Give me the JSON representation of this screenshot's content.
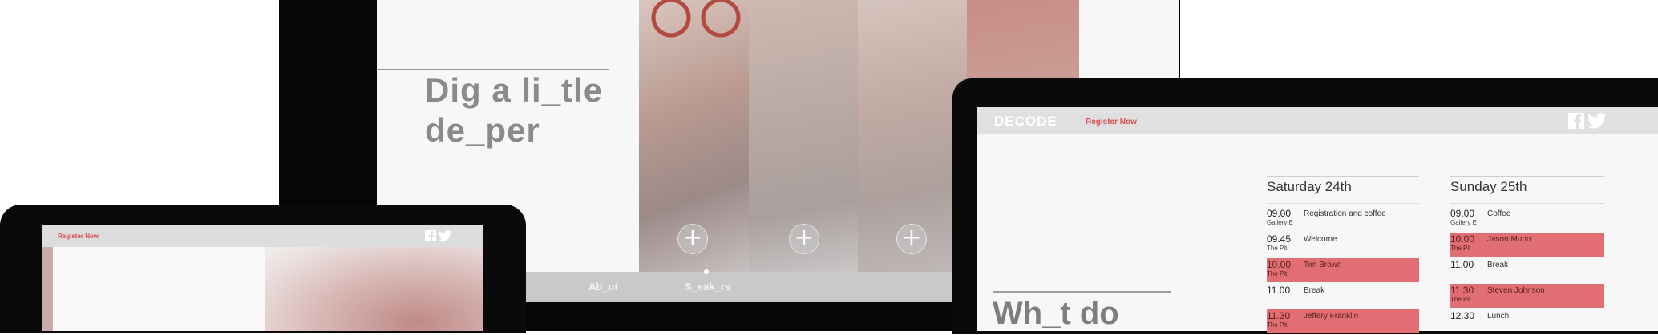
{
  "colors": {
    "accent": "#e06e73",
    "brand_red": "#d64e4e",
    "text_gray": "#8a8a8a"
  },
  "monitor": {
    "hero_title_line1": "Dig a li_tle",
    "hero_title_line2": "de_per",
    "speakers": [
      {
        "icon": "plus-icon"
      },
      {
        "icon": "plus-icon"
      },
      {
        "icon": "plus-icon"
      }
    ],
    "nav": {
      "about_label": "Ab_ut",
      "speakers_label": "S_eak_rs"
    }
  },
  "tablet": {
    "register_label": "Register Now",
    "icons": [
      "facebook-icon",
      "twitter-icon"
    ]
  },
  "laptop": {
    "logo": "DECODE",
    "register_label": "Register Now",
    "icons": [
      "facebook-icon",
      "twitter-icon"
    ],
    "heading_fragment": "Wh_t do",
    "days": [
      {
        "title": "Saturday 24th",
        "rows": [
          {
            "time": "09.00",
            "place": "Gallery E",
            "event": "Registration and coffee",
            "highlight": false
          },
          {
            "time": "09.45",
            "place": "The Pit",
            "event": "Welcome",
            "highlight": false
          },
          {
            "time": "10.00",
            "place": "The Pit",
            "event": "Tim Brown",
            "highlight": true
          },
          {
            "time": "11.00",
            "place": "",
            "event": "Break",
            "highlight": false
          },
          {
            "time": "11.30",
            "place": "The Pit",
            "event": "Jeffery Franklin",
            "highlight": true
          }
        ]
      },
      {
        "title": "Sunday 25th",
        "rows": [
          {
            "time": "09.00",
            "place": "Gallery E",
            "event": "Coffee",
            "highlight": false
          },
          {
            "time": "10.00",
            "place": "The Pit",
            "event": "Jason Munn",
            "highlight": true
          },
          {
            "time": "11.00",
            "place": "",
            "event": "Break",
            "highlight": false
          },
          {
            "time": "11.30",
            "place": "The Pit",
            "event": "Steven Johnson",
            "highlight": true
          },
          {
            "time": "12.30",
            "place": "",
            "event": "Lunch",
            "highlight": false
          }
        ]
      }
    ]
  }
}
